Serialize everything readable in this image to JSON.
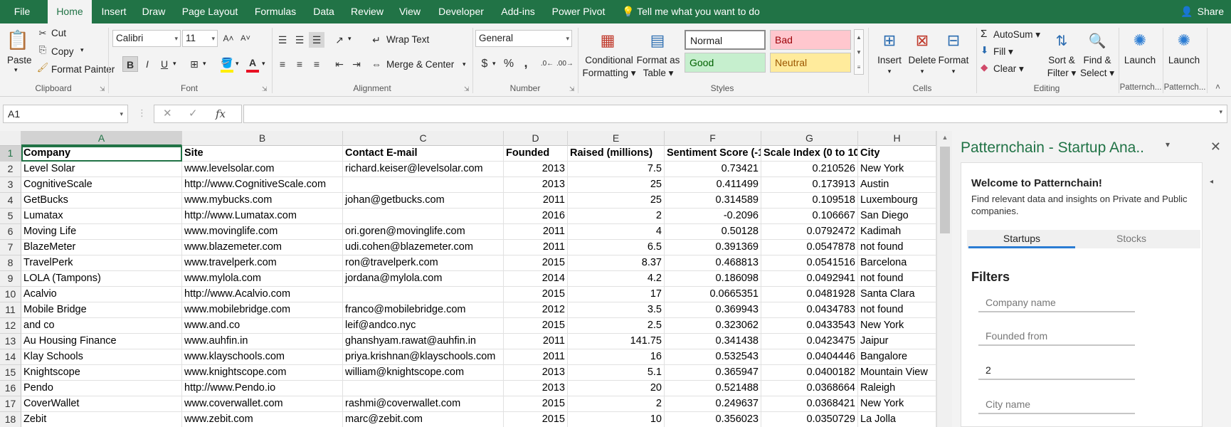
{
  "ribbon_tabs": [
    {
      "label": "File",
      "active": false
    },
    {
      "label": "Home",
      "active": true
    },
    {
      "label": "Insert",
      "active": false
    },
    {
      "label": "Draw",
      "active": false
    },
    {
      "label": "Page Layout",
      "active": false
    },
    {
      "label": "Formulas",
      "active": false
    },
    {
      "label": "Data",
      "active": false
    },
    {
      "label": "Review",
      "active": false
    },
    {
      "label": "View",
      "active": false
    },
    {
      "label": "Developer",
      "active": false
    },
    {
      "label": "Add-ins",
      "active": false
    },
    {
      "label": "Power Pivot",
      "active": false
    }
  ],
  "tell_me": "Tell me what you want to do",
  "share": "Share",
  "clipboard": {
    "paste": "Paste",
    "cut": "Cut",
    "copy": "Copy",
    "format_painter": "Format Painter",
    "label": "Clipboard"
  },
  "font": {
    "name": "Calibri",
    "size": "11",
    "label": "Font",
    "bold": "B",
    "italic": "I",
    "underline": "U",
    "font_color": "#e81123",
    "fill_color": "#ffee00"
  },
  "alignment": {
    "wrap": "Wrap Text",
    "merge": "Merge & Center",
    "label": "Alignment"
  },
  "number": {
    "format": "General",
    "currency": "$",
    "percent": "%",
    "comma": ",",
    "label": "Number"
  },
  "styles": {
    "conditional_1": "Conditional",
    "conditional_2": "Formatting",
    "table_1": "Format as",
    "table_2": "Table",
    "normal": "Normal",
    "bad": "Bad",
    "good": "Good",
    "neutral": "Neutral",
    "bad_bg": "#ffc7ce",
    "bad_fg": "#9c0006",
    "good_bg": "#c6efce",
    "good_fg": "#006100",
    "neutral_bg": "#ffeb9c",
    "neutral_fg": "#9c5700",
    "label": "Styles"
  },
  "cells_grp": {
    "insert": "Insert",
    "delete": "Delete",
    "format": "Format",
    "label": "Cells"
  },
  "editing": {
    "autosum": "AutoSum",
    "fill": "Fill",
    "clear": "Clear",
    "sort_1": "Sort &",
    "sort_2": "Filter",
    "find_1": "Find &",
    "find_2": "Select",
    "label": "Editing"
  },
  "addins": [
    {
      "launch": "Launch",
      "label": "Patternch..."
    },
    {
      "launch": "Launch",
      "label": "Patternch..."
    }
  ],
  "name_box": "A1",
  "fx": "fx",
  "columns": [
    "A",
    "B",
    "C",
    "D",
    "E",
    "F",
    "G",
    "H"
  ],
  "header_row": [
    "Company",
    "Site",
    "Contact E-mail",
    "Founded",
    "Raised (millions)",
    "Sentiment Score (-1",
    "Scale Index (0 to 10",
    "City"
  ],
  "rows": [
    [
      "Level Solar",
      "www.levelsolar.com",
      "richard.keiser@levelsolar.com",
      "2013",
      "7.5",
      "0.73421",
      "0.210526",
      "New York"
    ],
    [
      "CognitiveScale",
      "http://www.CognitiveScale.com",
      "",
      "2013",
      "25",
      "0.411499",
      "0.173913",
      "Austin"
    ],
    [
      "GetBucks",
      "www.mybucks.com",
      "johan@getbucks.com",
      "2011",
      "25",
      "0.314589",
      "0.109518",
      "Luxembourg"
    ],
    [
      "Lumatax",
      "http://www.Lumatax.com",
      "",
      "2016",
      "2",
      "-0.2096",
      "0.106667",
      "San Diego"
    ],
    [
      "Moving Life",
      "www.movinglife.com",
      "ori.goren@movinglife.com",
      "2011",
      "4",
      "0.50128",
      "0.0792472",
      "Kadimah"
    ],
    [
      "BlazeMeter",
      "www.blazemeter.com",
      "udi.cohen@blazemeter.com",
      "2011",
      "6.5",
      "0.391369",
      "0.0547878",
      "not found"
    ],
    [
      "TravelPerk",
      "www.travelperk.com",
      "ron@travelperk.com",
      "2015",
      "8.37",
      "0.468813",
      "0.0541516",
      "Barcelona"
    ],
    [
      "LOLA (Tampons)",
      "www.mylola.com",
      "jordana@mylola.com",
      "2014",
      "4.2",
      "0.186098",
      "0.0492941",
      "not found"
    ],
    [
      "Acalvio",
      "http://www.Acalvio.com",
      "",
      "2015",
      "17",
      "0.0665351",
      "0.0481928",
      "Santa Clara"
    ],
    [
      "Mobile Bridge",
      "www.mobilebridge.com",
      "franco@mobilebridge.com",
      "2012",
      "3.5",
      "0.369943",
      "0.0434783",
      "not found"
    ],
    [
      "and co",
      "www.and.co",
      "leif@andco.nyc",
      "2015",
      "2.5",
      "0.323062",
      "0.0433543",
      "New York"
    ],
    [
      "Au Housing Finance",
      "www.auhfin.in",
      "ghanshyam.rawat@auhfin.in",
      "2011",
      "141.75",
      "0.341438",
      "0.0423475",
      "Jaipur"
    ],
    [
      "Klay Schools",
      "www.klayschools.com",
      "priya.krishnan@klayschools.com",
      "2011",
      "16",
      "0.532543",
      "0.0404446",
      "Bangalore"
    ],
    [
      "Knightscope",
      "www.knightscope.com",
      "william@knightscope.com",
      "2013",
      "5.1",
      "0.365947",
      "0.0400182",
      "Mountain View"
    ],
    [
      "Pendo",
      "http://www.Pendo.io",
      "",
      "2013",
      "20",
      "0.521488",
      "0.0368664",
      "Raleigh"
    ],
    [
      "CoverWallet",
      "www.coverwallet.com",
      "rashmi@coverwallet.com",
      "2015",
      "2",
      "0.249637",
      "0.0368421",
      "New York"
    ],
    [
      "Zebit",
      "www.zebit.com",
      "marc@zebit.com",
      "2015",
      "10",
      "0.356023",
      "0.0350729",
      "La Jolla"
    ]
  ],
  "pane": {
    "title": "Patternchain - Startup Ana..",
    "welcome": "Welcome to Patternchain!",
    "description": "Find relevant data and insights on Private and Public companies.",
    "tabs": [
      "Startups",
      "Stocks"
    ],
    "filters_heading": "Filters",
    "fields": [
      {
        "placeholder": "Company name",
        "value": ""
      },
      {
        "placeholder": "Founded from",
        "value": ""
      },
      {
        "placeholder": "",
        "value": "2"
      },
      {
        "placeholder": "City name",
        "value": ""
      }
    ]
  }
}
